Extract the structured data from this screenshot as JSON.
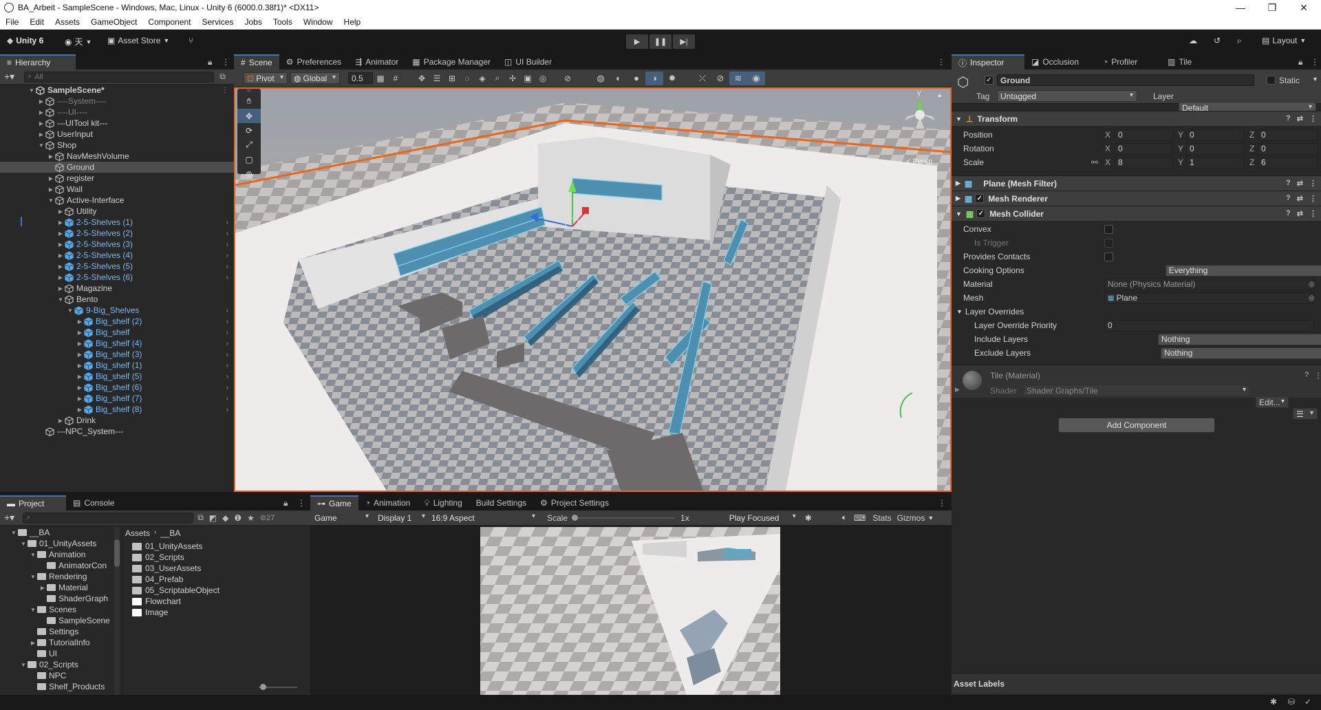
{
  "window": {
    "title": "BA_Arbeit - SampleScene - Windows, Mac, Linux - Unity 6 (6000.0.38f1)* <DX11>",
    "minimize": "—",
    "maximize": "❐",
    "close": "✕"
  },
  "menu": [
    "File",
    "Edit",
    "Assets",
    "GameObject",
    "Component",
    "Services",
    "Jobs",
    "Tools",
    "Window",
    "Help"
  ],
  "toolbar": {
    "unity_label": "Unity 6",
    "account_label": "天",
    "asset_store_label": "Asset Store",
    "layout_label": "Layout"
  },
  "hierarchy": {
    "tab_label": "Hierarchy",
    "search_placeholder": "All",
    "rows": [
      {
        "label": "SampleScene*",
        "indent": 0,
        "tri": "▼",
        "icon": "unity"
      },
      {
        "label": "----System----",
        "indent": 1,
        "tri": "▶",
        "icon": "cube"
      },
      {
        "label": "----UI----",
        "indent": 1,
        "tri": "▶",
        "icon": "cube"
      },
      {
        "label": "---UITool kit---",
        "indent": 1,
        "tri": "▶",
        "icon": "cube"
      },
      {
        "label": "UserInput",
        "indent": 1,
        "tri": "▶",
        "icon": "cube"
      },
      {
        "label": "Shop",
        "indent": 1,
        "tri": "▼",
        "icon": "cube"
      },
      {
        "label": "NavMeshVolume",
        "indent": 2,
        "tri": "▶",
        "icon": "cube"
      },
      {
        "label": "Ground",
        "indent": 2,
        "tri": "",
        "icon": "cube"
      },
      {
        "label": "register",
        "indent": 2,
        "tri": "▶",
        "icon": "cube"
      },
      {
        "label": "Wall",
        "indent": 2,
        "tri": "▶",
        "icon": "cube"
      },
      {
        "label": "Active-Interface",
        "indent": 2,
        "tri": "▼",
        "icon": "cube"
      },
      {
        "label": "Utility",
        "indent": 3,
        "tri": "▶",
        "icon": "cube"
      },
      {
        "label": "2-5-Shelves (1)",
        "indent": 3,
        "tri": "▶",
        "icon": "prefab"
      },
      {
        "label": "2-5-Shelves (2)",
        "indent": 3,
        "tri": "▶",
        "icon": "prefab"
      },
      {
        "label": "2-5-Shelves (3)",
        "indent": 3,
        "tri": "▶",
        "icon": "prefab"
      },
      {
        "label": "2-5-Shelves (4)",
        "indent": 3,
        "tri": "▶",
        "icon": "prefab"
      },
      {
        "label": "2-5-Shelves (5)",
        "indent": 3,
        "tri": "▶",
        "icon": "prefab"
      },
      {
        "label": "2-5-Shelves (6)",
        "indent": 3,
        "tri": "▶",
        "icon": "prefab"
      },
      {
        "label": "Magazine",
        "indent": 3,
        "tri": "▶",
        "icon": "cube"
      },
      {
        "label": "Bento",
        "indent": 3,
        "tri": "▼",
        "icon": "cube"
      },
      {
        "label": "9-Big_Shelves",
        "indent": 4,
        "tri": "▼",
        "icon": "prefab"
      },
      {
        "label": "Big_shelf (2)",
        "indent": 5,
        "tri": "▶",
        "icon": "prefab"
      },
      {
        "label": "Big_shelf",
        "indent": 5,
        "tri": "▶",
        "icon": "prefab"
      },
      {
        "label": "Big_shelf (4)",
        "indent": 5,
        "tri": "▶",
        "icon": "prefab"
      },
      {
        "label": "Big_shelf (3)",
        "indent": 5,
        "tri": "▶",
        "icon": "prefab"
      },
      {
        "label": "Big_shelf (1)",
        "indent": 5,
        "tri": "▶",
        "icon": "prefab"
      },
      {
        "label": "Big_shelf (5)",
        "indent": 5,
        "tri": "▶",
        "icon": "prefab"
      },
      {
        "label": "Big_shelf (6)",
        "indent": 5,
        "tri": "▶",
        "icon": "prefab"
      },
      {
        "label": "Big_shelf (7)",
        "indent": 5,
        "tri": "▶",
        "icon": "prefab"
      },
      {
        "label": "Big_shelf (8)",
        "indent": 5,
        "tri": "▶",
        "icon": "prefab"
      },
      {
        "label": "Drink",
        "indent": 3,
        "tri": "▶",
        "icon": "cube"
      },
      {
        "label": "---NPC_System---",
        "indent": 1,
        "tri": "",
        "icon": "cube"
      }
    ]
  },
  "scene_tabs": [
    "Scene",
    "Preferences",
    "Animator",
    "Package Manager",
    "UI Builder"
  ],
  "scene_toolbar": {
    "pivot": "Pivot",
    "global": "Global",
    "snap": "0.5"
  },
  "scene_view": {
    "persp_label": "< Persp",
    "gizmo_y": "y"
  },
  "inspector": {
    "tabs": [
      "Inspector",
      "Occlusion",
      "Profiler",
      "Tile"
    ],
    "object_name": "Ground",
    "static_label": "Static",
    "tag_label": "Tag",
    "tag_value": "Untagged",
    "layer_label": "Layer",
    "layer_value": "Default",
    "transform": {
      "title": "Transform",
      "position_label": "Position",
      "rotation_label": "Rotation",
      "scale_label": "Scale",
      "position": [
        "0",
        "0",
        "0"
      ],
      "rotation": [
        "0",
        "0",
        "0"
      ],
      "scale": [
        "8",
        "1",
        "6"
      ]
    },
    "components": [
      "Plane (Mesh Filter)",
      "Mesh Renderer",
      "Mesh Collider"
    ],
    "collider": {
      "convex": "Convex",
      "is_trigger": "Is Trigger",
      "provides_contacts": "Provides Contacts",
      "cooking_label": "Cooking Options",
      "cooking_value": "Everything",
      "material_label": "Material",
      "material_value": "None (Physics Material)",
      "mesh_label": "Mesh",
      "mesh_value": "Plane",
      "layer_overrides": "Layer Overrides",
      "priority_label": "Layer Override Priority",
      "priority_value": "0",
      "include_label": "Include Layers",
      "include_value": "Nothing",
      "exclude_label": "Exclude Layers",
      "exclude_value": "Nothing"
    },
    "material": {
      "title": "Tile (Material)",
      "shader_label": "Shader",
      "shader_value": "Shader Graphs/Tile",
      "edit_label": "Edit..."
    },
    "add_component": "Add Component",
    "asset_labels": "Asset Labels"
  },
  "project": {
    "tabs": [
      "Project",
      "Console"
    ],
    "count": "27",
    "tree": [
      {
        "label": "__BA",
        "indent": 0,
        "tri": "▼"
      },
      {
        "label": "01_UnityAssets",
        "indent": 1,
        "tri": "▼"
      },
      {
        "label": "Animation",
        "indent": 2,
        "tri": "▼"
      },
      {
        "label": "AnimatorCon",
        "indent": 3,
        "tri": ""
      },
      {
        "label": "Rendering",
        "indent": 2,
        "tri": "▼"
      },
      {
        "label": "Material",
        "indent": 3,
        "tri": "▶"
      },
      {
        "label": "ShaderGraph",
        "indent": 3,
        "tri": ""
      },
      {
        "label": "Scenes",
        "indent": 2,
        "tri": "▼"
      },
      {
        "label": "SampleScene",
        "indent": 3,
        "tri": ""
      },
      {
        "label": "Settings",
        "indent": 2,
        "tri": ""
      },
      {
        "label": "TutorialInfo",
        "indent": 2,
        "tri": "▶"
      },
      {
        "label": "UI",
        "indent": 2,
        "tri": ""
      },
      {
        "label": "02_Scripts",
        "indent": 1,
        "tri": "▼"
      },
      {
        "label": "NPC",
        "indent": 2,
        "tri": ""
      },
      {
        "label": "Shelf_Products",
        "indent": 2,
        "tri": ""
      }
    ],
    "breadcrumb": [
      "Assets",
      "__BA"
    ],
    "files": [
      {
        "label": "01_UnityAssets",
        "kind": "folder"
      },
      {
        "label": "02_Scripts",
        "kind": "folder"
      },
      {
        "label": "03_UserAssets",
        "kind": "folder"
      },
      {
        "label": "04_Prefab",
        "kind": "folder"
      },
      {
        "label": "05_ScriptableObject",
        "kind": "folder"
      },
      {
        "label": "Flowchart",
        "kind": "white"
      },
      {
        "label": "Image",
        "kind": "white"
      }
    ]
  },
  "game": {
    "tabs": [
      "Game",
      "Animation",
      "Lighting",
      "Build Settings",
      "Project Settings"
    ],
    "mode": "Game",
    "display": "Display 1",
    "aspect": "16:9 Aspect",
    "scale_label": "Scale",
    "scale_value": "1x",
    "play_focus": "Play Focused",
    "stats": "Stats",
    "gizmos": "Gizmos"
  }
}
